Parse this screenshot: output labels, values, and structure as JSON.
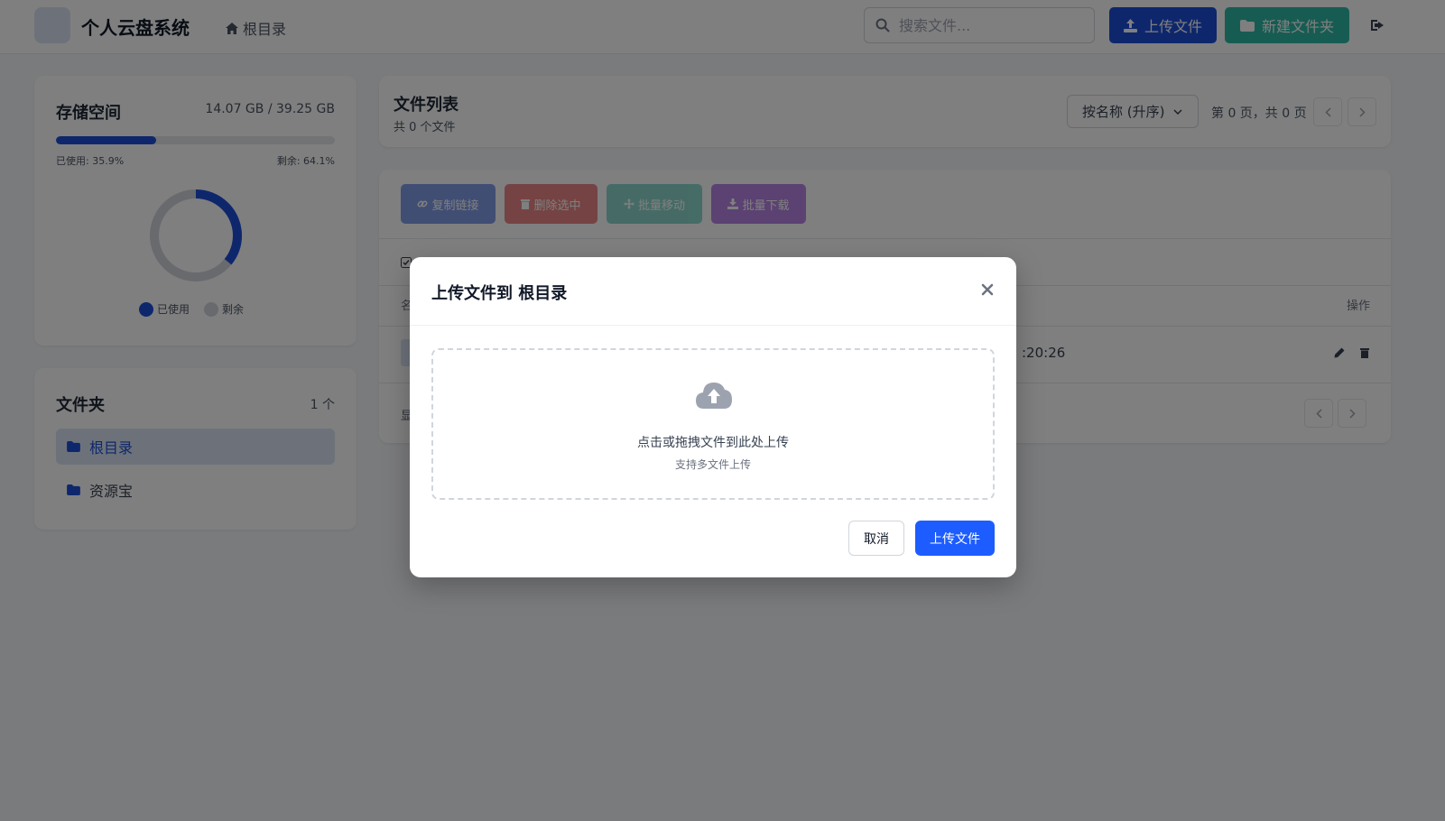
{
  "header": {
    "app_title": "个人云盘系统",
    "breadcrumb": "根目录",
    "search_placeholder": "搜索文件...",
    "upload_label": "上传文件",
    "new_folder_label": "新建文件夹"
  },
  "storage": {
    "title": "存储空间",
    "size_text": "14.07 GB / 39.25 GB",
    "used_label": "已使用: 35.9%",
    "free_label": "剩余: 64.1%",
    "used_fraction": 0.359,
    "legend_used": "已使用",
    "legend_free": "剩余",
    "used_color": "#1d4ed8",
    "free_color": "#d1d5db"
  },
  "folders": {
    "title": "文件夹",
    "count": "1 个",
    "items": [
      {
        "label": "根目录",
        "active": true
      },
      {
        "label": "资源宝",
        "active": false
      }
    ]
  },
  "file_list": {
    "title": "文件列表",
    "count_text": "共 0 个文件",
    "sort_value": "按名称 (升序)",
    "page_info": "第 0 页，共 0 页",
    "actions": {
      "copy_link": "复制链接",
      "delete_selected": "删除选中",
      "batch_move": "批量移动",
      "batch_download": "批量下载"
    },
    "col_name_partial": "名",
    "col_actions": "操作",
    "row_time_partial": ":20:26",
    "footer_partial": "显"
  },
  "modal": {
    "title": "上传文件到 根目录",
    "drop_main": "点击或拖拽文件到此处上传",
    "drop_sub": "支持多文件上传",
    "cancel_label": "取消",
    "upload_label": "上传文件"
  }
}
